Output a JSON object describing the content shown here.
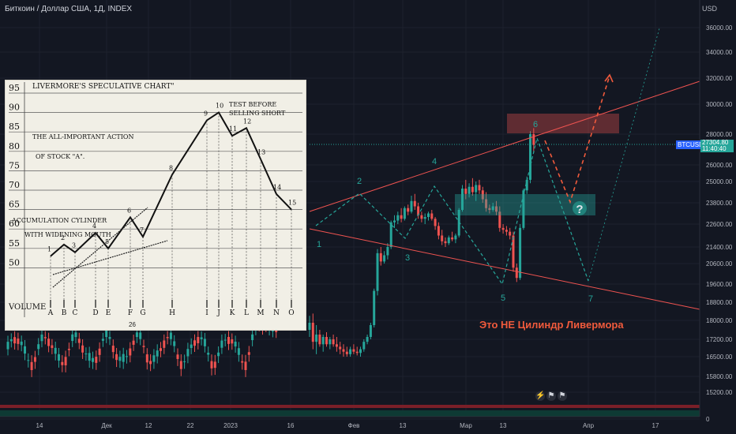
{
  "header": {
    "symbol": "Биткоин / Доллар США, 1Д, INDEX",
    "currency": "USD"
  },
  "price_tag": {
    "ticker": "BTCUSD",
    "price": "27304.80",
    "countdown": "11:40:40"
  },
  "caption": "Это НЕ Цилиндр Ливермора",
  "colors": {
    "background": "#131722",
    "up": "#26a69a",
    "down": "#ef5350",
    "accent": "#f05a3c",
    "projection": "#26a69a",
    "price_label": "#26a69a"
  },
  "chart_data": {
    "type": "candlestick",
    "y_axis": {
      "ticks": [
        "36000.00",
        "34000.00",
        "32000.00",
        "30000.00",
        "28000.00",
        "26000.00",
        "25000.00",
        "23800.00",
        "22600.00",
        "21400.00",
        "20600.00",
        "19600.00",
        "18800.00",
        "18000.00",
        "17200.00",
        "16500.00",
        "15800.00",
        "15200.00",
        "0"
      ],
      "scale": "log"
    },
    "x_axis": {
      "ticks": [
        "14",
        "Дек",
        "12",
        "22",
        "2023",
        "16",
        "Фев",
        "13",
        "Мар",
        "13",
        "Апр",
        "17"
      ]
    },
    "wave_labels": [
      "1",
      "2",
      "3",
      "4",
      "5",
      "6",
      "7"
    ],
    "question_mark": "?",
    "candles_ohlc": [
      [
        17600,
        18200,
        17300,
        17900
      ],
      [
        17900,
        18300,
        16800,
        17100
      ],
      [
        17100,
        17800,
        16600,
        17400
      ],
      [
        17400,
        17600,
        16900,
        17000
      ],
      [
        17000,
        17400,
        16700,
        17300
      ],
      [
        17300,
        17500,
        16900,
        17000
      ],
      [
        17000,
        17300,
        16800,
        17200
      ],
      [
        17200,
        17400,
        16900,
        17000
      ],
      [
        17000,
        17300,
        16700,
        16900
      ],
      [
        16900,
        17100,
        16600,
        16800
      ],
      [
        16800,
        17000,
        16500,
        16700
      ],
      [
        16700,
        16900,
        16500,
        16600
      ],
      [
        16600,
        16900,
        16500,
        16800
      ],
      [
        16800,
        17000,
        16600,
        16700
      ],
      [
        16700,
        16900,
        16550,
        16650
      ],
      [
        16650,
        16900,
        16500,
        16800
      ],
      [
        16800,
        17200,
        16700,
        17100
      ],
      [
        17100,
        17400,
        17000,
        17300
      ],
      [
        17300,
        17900,
        17200,
        17800
      ],
      [
        17800,
        19400,
        17700,
        19300
      ],
      [
        19300,
        21300,
        19100,
        21100
      ],
      [
        21100,
        21400,
        20500,
        20700
      ],
      [
        20700,
        21200,
        20600,
        21000
      ],
      [
        21000,
        21600,
        20800,
        21400
      ],
      [
        21400,
        22800,
        21300,
        22700
      ],
      [
        22700,
        23100,
        22400,
        22800
      ],
      [
        22800,
        23300,
        22600,
        23100
      ],
      [
        23100,
        23500,
        22700,
        22900
      ],
      [
        22900,
        23600,
        22800,
        23500
      ],
      [
        23500,
        23700,
        23100,
        23300
      ],
      [
        23300,
        24200,
        23200,
        23900
      ],
      [
        23900,
        24300,
        23400,
        23600
      ],
      [
        23600,
        23800,
        22900,
        23100
      ],
      [
        23100,
        23300,
        22700,
        22900
      ],
      [
        22900,
        23200,
        22600,
        23000
      ],
      [
        23000,
        23300,
        22800,
        23200
      ],
      [
        23200,
        23400,
        22800,
        22900
      ],
      [
        22900,
        23000,
        22300,
        22500
      ],
      [
        22500,
        22700,
        21800,
        22000
      ],
      [
        22000,
        22300,
        21500,
        21700
      ],
      [
        21700,
        21900,
        21400,
        21600
      ],
      [
        21600,
        22000,
        21500,
        21900
      ],
      [
        21900,
        22200,
        21700,
        21800
      ],
      [
        21800,
        22100,
        21600,
        22000
      ],
      [
        22000,
        23500,
        21900,
        23400
      ],
      [
        23400,
        24800,
        23300,
        24600
      ],
      [
        24600,
        25100,
        24000,
        24300
      ],
      [
        24300,
        24900,
        24100,
        24700
      ],
      [
        24700,
        25200,
        24200,
        24400
      ],
      [
        24400,
        25000,
        23900,
        24800
      ],
      [
        24800,
        25100,
        24300,
        24500
      ],
      [
        24500,
        24700,
        23800,
        24000
      ],
      [
        24000,
        24400,
        23300,
        23500
      ],
      [
        23500,
        23700,
        23200,
        23400
      ],
      [
        23400,
        23800,
        23300,
        23600
      ],
      [
        23600,
        23900,
        23100,
        23300
      ],
      [
        23300,
        23600,
        22200,
        22400
      ],
      [
        22400,
        22600,
        22100,
        22300
      ],
      [
        22300,
        22500,
        22000,
        22200
      ],
      [
        22200,
        22400,
        21800,
        22000
      ],
      [
        22000,
        22200,
        20200,
        20400
      ],
      [
        20400,
        20600,
        19700,
        19900
      ],
      [
        19900,
        22600,
        19800,
        22400
      ],
      [
        22400,
        24600,
        22300,
        24500
      ],
      [
        24500,
        25300,
        24300,
        25100
      ],
      [
        25100,
        28200,
        24900,
        28000
      ],
      [
        28000,
        28400,
        26800,
        27300
      ]
    ],
    "scenarios": [
      {
        "style": "solid-thin",
        "points": [
          [
            "pre-rally",
            20000
          ],
          [
            "late-Apr",
            36500
          ]
        ]
      },
      {
        "style": "dashed",
        "points": [
          [
            "peak",
            28000
          ],
          [
            "drop",
            23800
          ],
          [
            "up",
            32300
          ]
        ]
      },
      {
        "style": "dashed",
        "points": [
          [
            "peak",
            28000
          ],
          [
            "bottom",
            19800
          ],
          [
            "recovery",
            26000
          ]
        ]
      }
    ]
  },
  "inset": {
    "title": "LIVERMORE'S SPECULATIVE CHART\"",
    "notes": [
      "TEST BEFORE",
      "SELLING SHORT",
      "THE ALL-IMPORTANT ACTION",
      "OF STOCK \"A\".",
      "ACCUMULATION CYLINDER",
      "WITH WIDENING MOUTH"
    ],
    "y_ticks": [
      "95",
      "90",
      "85",
      "80",
      "75",
      "70",
      "65",
      "60",
      "55",
      "50"
    ],
    "x_labels": [
      "A",
      "B",
      "C",
      "D",
      "E",
      "F",
      "G",
      "H",
      "I",
      "J",
      "K",
      "L",
      "M",
      "N",
      "O"
    ],
    "volume_label": "VOLUME",
    "point_labels": [
      "1",
      "2",
      "3",
      "4",
      "5",
      "6",
      "7",
      "8",
      "9",
      "10",
      "11",
      "12",
      "13",
      "14",
      "15"
    ],
    "path": [
      [
        1,
        53
      ],
      [
        2,
        56
      ],
      [
        3,
        54
      ],
      [
        4,
        59
      ],
      [
        5,
        55
      ],
      [
        6,
        63
      ],
      [
        7,
        58
      ],
      [
        8,
        74
      ],
      [
        9,
        88
      ],
      [
        10,
        90
      ],
      [
        11,
        84
      ],
      [
        12,
        86
      ],
      [
        13,
        78
      ],
      [
        14,
        69
      ],
      [
        15,
        65
      ]
    ]
  },
  "footnote": "26"
}
